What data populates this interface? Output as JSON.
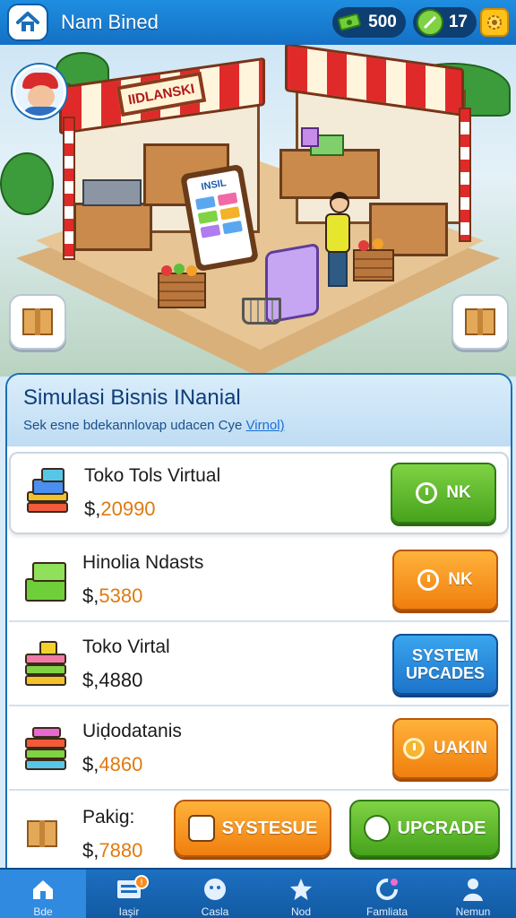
{
  "header": {
    "title": "Nam Bined",
    "cash": "500",
    "gems": "17"
  },
  "scene": {
    "shop_sign": "IIDLANSKI",
    "board_title": "INSIL"
  },
  "panel": {
    "title": "Simulasi Bisnis INanial",
    "subtitle": "Sek esne bdekannlovap udacen Cye ",
    "subtitle_link": "Virnol)"
  },
  "items": [
    {
      "name": "Toko Tols Virtual",
      "currency": "$,",
      "price": "20990",
      "action": "NK",
      "action_color": "green"
    },
    {
      "name": "Hinolia Ndasts",
      "currency": "$,",
      "price": "5380",
      "action": "NK",
      "action_color": "orange"
    },
    {
      "name": "Toko Virtal",
      "currency": "$,",
      "price": "4880",
      "action": "SYSTEM UPCADES",
      "action_color": "blue"
    },
    {
      "name": "Uiḍodatanis",
      "currency": "$,",
      "price": "4860",
      "action": "UAKIN",
      "action_color": "orange"
    },
    {
      "name": "Pakig:",
      "currency": "$,",
      "price": "7880",
      "action_secondary": "SYSTESUE",
      "action_primary": "UPCRADE"
    }
  ],
  "nav": {
    "items": [
      {
        "label": "Bde",
        "icon": "home-icon",
        "active": true
      },
      {
        "label": "Iaşir",
        "icon": "list-icon",
        "badge": "!"
      },
      {
        "label": "Casla",
        "icon": "face-icon"
      },
      {
        "label": "Nod",
        "icon": "star-icon"
      },
      {
        "label": "Famliata",
        "icon": "refresh-gear-icon"
      },
      {
        "label": "Nemun",
        "icon": "person-icon"
      }
    ]
  },
  "colors": {
    "primary_blue": "#1a6fb8",
    "green": "#46a31c",
    "orange": "#f07f0f",
    "price_orange": "#e07a10"
  }
}
